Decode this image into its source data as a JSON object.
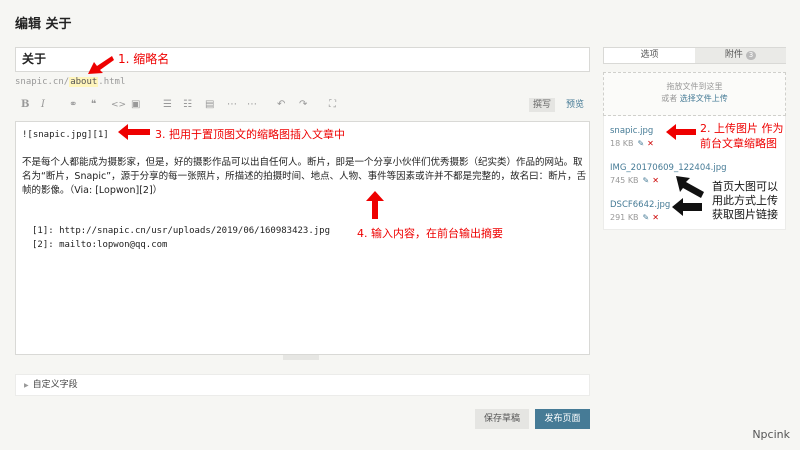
{
  "page": {
    "title": "编辑 关于"
  },
  "title_field": {
    "value": "关于"
  },
  "slug": {
    "prefix": "snapic.cn/",
    "value": "about",
    "suffix": ".html"
  },
  "toolbar": {
    "bold": "B",
    "italic": "I",
    "link": "⚭",
    "quote": "❝",
    "code": "<>",
    "image": "▣",
    "ol": "☰",
    "ul": "☷",
    "hr": "▤",
    "more": "⋯",
    "undo": "↶",
    "redo": "↷",
    "fullscreen": "⛶",
    "write_tab": "撰写",
    "preview_tab": "预览"
  },
  "editor": {
    "line1": "![snapic.jpg][1]",
    "para1": "不是每个人都能成为摄影家，但是，好的摄影作品可以出自任何人。断片，即是一个分享小伙伴们优秀摄影（纪实类）作品的网站。取",
    "para2": "名为“断片，Snapic”，源于分享的每一张照片，所描述的拍摄时间、地点、人物、事件等因素或许并不都是完整的，故名曰：断片，舌",
    "para3": "帧的影像。（Via: [Lopwon][2]）",
    "ref1": "[1]: http://snapic.cn/usr/uploads/2019/06/160983423.jpg",
    "ref2": "[2]: mailto:lopwon@qq.com"
  },
  "custom_fields": {
    "label": "自定义字段"
  },
  "buttons": {
    "save": "保存草稿",
    "publish": "发布页面"
  },
  "sidebar": {
    "tab_options": "选项",
    "tab_attachments": "附件",
    "attachments_count": "3",
    "upload_hint": "拖放文件到这里",
    "upload_or": "或者",
    "upload_link": "选择文件上传",
    "files": [
      {
        "name": "snapic.jpg",
        "size": "18 KB"
      },
      {
        "name": "IMG_20170609_122404.jpg",
        "size": "745 KB"
      },
      {
        "name": "DSCF6642.jpg",
        "size": "291 KB"
      }
    ]
  },
  "annotations": {
    "a1": "1. 缩略名",
    "a2_line1": "2. 上传图片 作为",
    "a2_line2": "前台文章缩略图",
    "a3": "3. 把用于置顶图文的缩略图插入文章中",
    "a4": "4. 输入内容，在前台输出摘要",
    "a5_line1": "首页大图可以",
    "a5_line2": "用此方式上传",
    "a5_line3": "获取图片链接"
  },
  "watermark": "Npcink"
}
